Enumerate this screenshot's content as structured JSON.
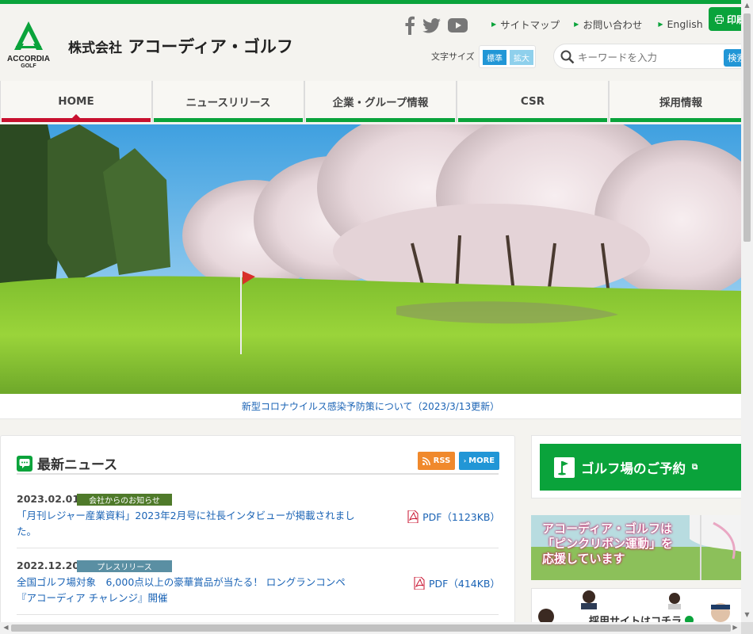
{
  "header": {
    "logo_text_1": "ACCORDIA",
    "logo_text_2": "GOLF",
    "company_prefix": "株式会社",
    "company_name": "アコーディア・ゴルフ",
    "social_icons": [
      "facebook-icon",
      "twitter-icon",
      "youtube-icon"
    ],
    "links": [
      "サイトマップ",
      "お問い合わせ",
      "English"
    ],
    "print_label": "印刷",
    "fontsize_label": "文字サイズ",
    "fontsize_standard": "標準",
    "fontsize_large": "拡大",
    "search_placeholder": "キーワードを入力",
    "search_button": "検索"
  },
  "nav": {
    "items": [
      "HOME",
      "ニュースリリース",
      "企業・グループ情報",
      "CSR",
      "採用情報"
    ],
    "active": "HOME"
  },
  "notice": {
    "text": "新型コロナウイルス感染予防策について（2023/3/13更新）"
  },
  "news": {
    "title": "最新ニュース",
    "rss_label": "RSS",
    "more_label": "MORE",
    "items": [
      {
        "date": "2023.02.01",
        "category": "会社からのお知らせ",
        "category_color": "#4f7a2a",
        "text": "「月刊レジャー産業資料」2023年2月号に社長インタビューが掲載されました。",
        "pdf": "PDF（1123KB）"
      },
      {
        "date": "2022.12.20",
        "category": "プレスリリース",
        "category_color": "#5a8fa3",
        "text": "全国ゴルフ場対象　6,000点以上の豪華賞品が当たる！ ロングランコンペ『アコーディア チャレンジ』開催",
        "pdf": "PDF（414KB）"
      }
    ]
  },
  "sidebar": {
    "booking_label": "ゴルフ場のご予約",
    "pink_banner_line1": "アコーディア・ゴルフは",
    "pink_banner_line2": "「ピンクリボン運動」を",
    "pink_banner_line3": "応援しています",
    "recruit_banner": "採用サイトはコチラ"
  },
  "colors": {
    "brand_green": "#0aa33b",
    "active_red": "#c8102e",
    "link_blue": "#1a63b5",
    "button_blue": "#2196d6",
    "rss_orange": "#f0892c"
  }
}
